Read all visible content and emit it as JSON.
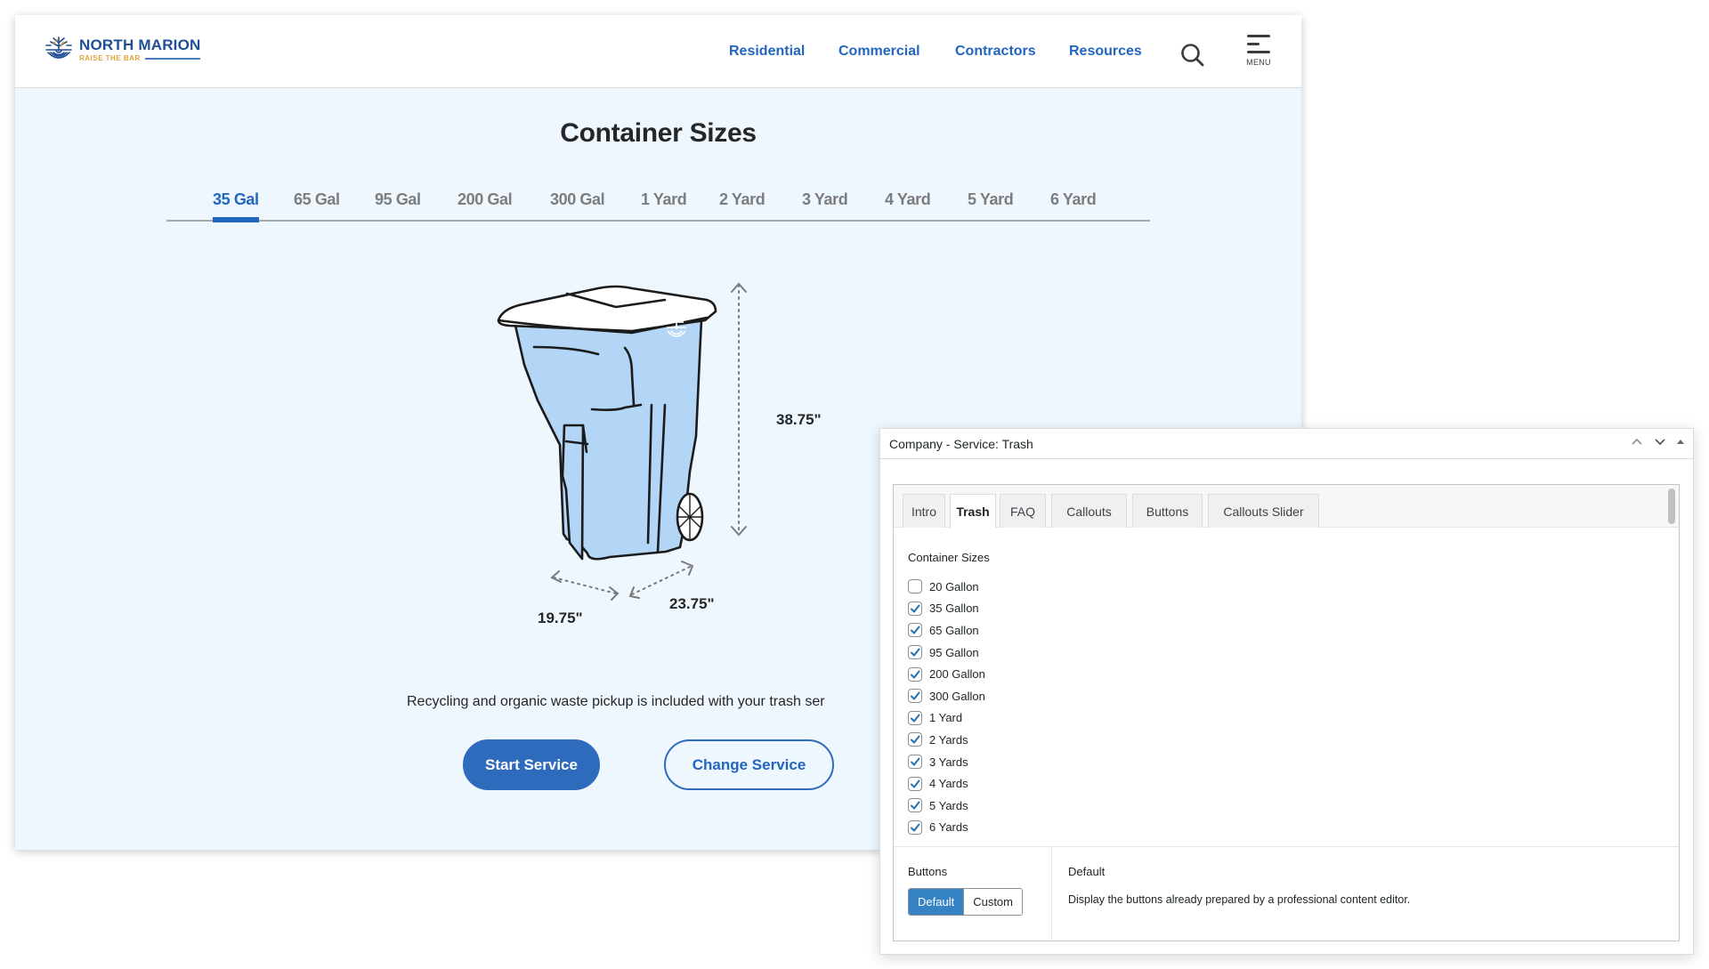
{
  "site": {
    "brand": {
      "name": "NORTH MARION",
      "tagline": "RAISE THE BAR"
    },
    "nav": [
      "Residential",
      "Commercial",
      "Contractors",
      "Resources"
    ],
    "menu_label": "MENU",
    "icons": {
      "search": "search-icon",
      "menu": "hamburger-menu-icon",
      "logo": "tree-logo-icon"
    },
    "title": "Container Sizes",
    "size_tabs": [
      "35 Gal",
      "65 Gal",
      "95 Gal",
      "200 Gal",
      "300 Gal",
      "1 Yard",
      "2 Yard",
      "3 Yard",
      "4 Yard",
      "5 Yard",
      "6 Yard"
    ],
    "active_tab": "35 Gal",
    "dimensions": {
      "height": "38.75\"",
      "width": "19.75\"",
      "depth": "23.75\""
    },
    "note": "Recycling and organic waste pickup is included with your trash ser",
    "buttons": {
      "start": "Start Service",
      "change": "Change Service"
    },
    "colors": {
      "accent": "#2266c0",
      "background": "#eef6fe",
      "bin": "#b3d6f7"
    }
  },
  "panel": {
    "title": "Company - Service: Trash",
    "controls": [
      "move-up",
      "move-down",
      "collapse"
    ],
    "tabs": [
      "Intro",
      "Trash",
      "FAQ",
      "Callouts",
      "Buttons",
      "Callouts Slider"
    ],
    "active_tab": "Trash",
    "section_label": "Container Sizes",
    "checkboxes": [
      {
        "label": "20 Gallon",
        "checked": false
      },
      {
        "label": "35 Gallon",
        "checked": true
      },
      {
        "label": "65 Gallon",
        "checked": true
      },
      {
        "label": "95 Gallon",
        "checked": true
      },
      {
        "label": "200 Gallon",
        "checked": true
      },
      {
        "label": "300 Gallon",
        "checked": true
      },
      {
        "label": "1 Yard",
        "checked": true
      },
      {
        "label": "2 Yards",
        "checked": true
      },
      {
        "label": "3 Yards",
        "checked": true
      },
      {
        "label": "4 Yards",
        "checked": true
      },
      {
        "label": "5 Yards",
        "checked": true
      },
      {
        "label": "6 Yards",
        "checked": true
      }
    ],
    "buttons_field": {
      "label": "Buttons",
      "options": [
        "Default",
        "Custom"
      ],
      "selected": "Default",
      "description_title": "Default",
      "description": "Display the buttons already prepared by a professional content editor."
    },
    "colors": {
      "primary": "#3582c4"
    }
  }
}
